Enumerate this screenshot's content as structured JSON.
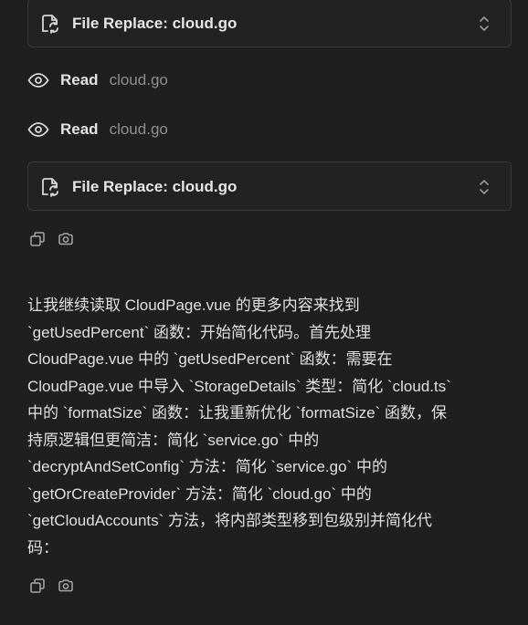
{
  "cards": [
    {
      "label": "File Replace: cloud.go"
    },
    {
      "label": "File Replace: cloud.go"
    }
  ],
  "reads": [
    {
      "verb": "Read",
      "file": "cloud.go"
    },
    {
      "verb": "Read",
      "file": "cloud.go"
    }
  ],
  "message": {
    "lines": [
      "让我继续读取 CloudPage.vue 的更多内容来找到",
      "`getUsedPercent` 函数：开始简化代码。首先处理",
      "CloudPage.vue 中的 `getUsedPercent` 函数：需要在",
      "CloudPage.vue 中导入 `StorageDetails` 类型：简化 `cloud.ts`",
      "中的 `formatSize` 函数：让我重新优化 `formatSize` 函数，保",
      "持原逻辑但更简洁：简化 `service.go` 中的",
      "`decryptAndSetConfig` 方法：简化 `service.go` 中的",
      "`getOrCreateProvider` 方法：简化 `cloud.go` 中的",
      "`getCloudAccounts` 方法，将内部类型移到包级别并简化代",
      "码："
    ]
  },
  "icons": {
    "file_replace": "file-replace-icon",
    "expand": "chevron-up-down-icon",
    "read": "eye-icon",
    "copy": "copy-icon",
    "snapshot": "camera-icon"
  },
  "colors": {
    "background": "#1f1f1f",
    "card_border": "#3a3a3a",
    "text": "#e0e0e0",
    "muted": "#8f8f8f"
  }
}
